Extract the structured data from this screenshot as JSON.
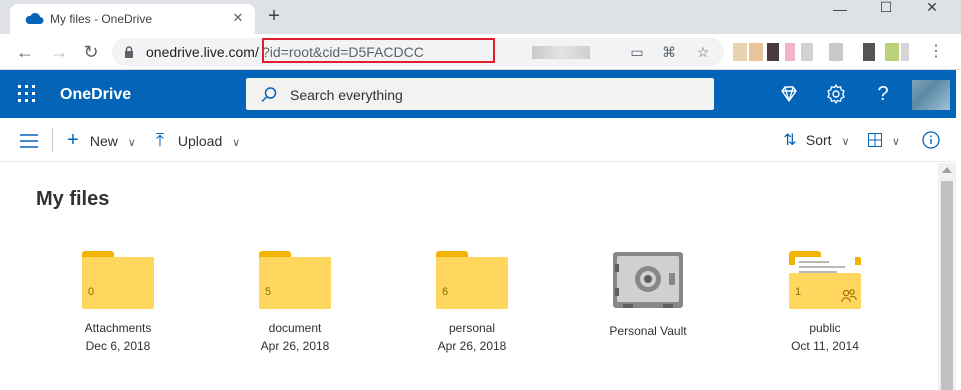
{
  "browser": {
    "tab_title": "My files - OneDrive",
    "tab_close": "✕",
    "new_tab": "+",
    "window": {
      "minimize": "—",
      "maximize": "☐",
      "close": "✕"
    },
    "url_host": "onedrive.live.com/",
    "url_path": "?id=root&cid=D5FACDCC",
    "icons": [
      "back-icon",
      "forward-icon",
      "reload-icon",
      "lock-icon",
      "cast-icon",
      "translate-icon",
      "star-icon",
      "menu-icon"
    ],
    "highlight_color": "#e0202e"
  },
  "header": {
    "brand": "OneDrive",
    "search_placeholder": "Search everything",
    "icons": [
      "waffle-icon",
      "premium-diamond-icon",
      "settings-icon",
      "help-icon"
    ],
    "color": "#0364b8"
  },
  "commands": {
    "new": "New",
    "upload": "Upload",
    "sort": "Sort"
  },
  "page": {
    "title": "My files"
  },
  "items": [
    {
      "name": "Attachments",
      "date": "Dec 6, 2018",
      "count": "0",
      "kind": "folder"
    },
    {
      "name": "document",
      "date": "Apr 26, 2018",
      "count": "5",
      "kind": "folder"
    },
    {
      "name": "personal",
      "date": "Apr 26, 2018",
      "count": "6",
      "kind": "folder"
    },
    {
      "name": "Personal Vault",
      "date": "",
      "count": "",
      "kind": "vault"
    },
    {
      "name": "public",
      "date": "Oct 11, 2014",
      "count": "1",
      "kind": "shared-folder"
    }
  ]
}
